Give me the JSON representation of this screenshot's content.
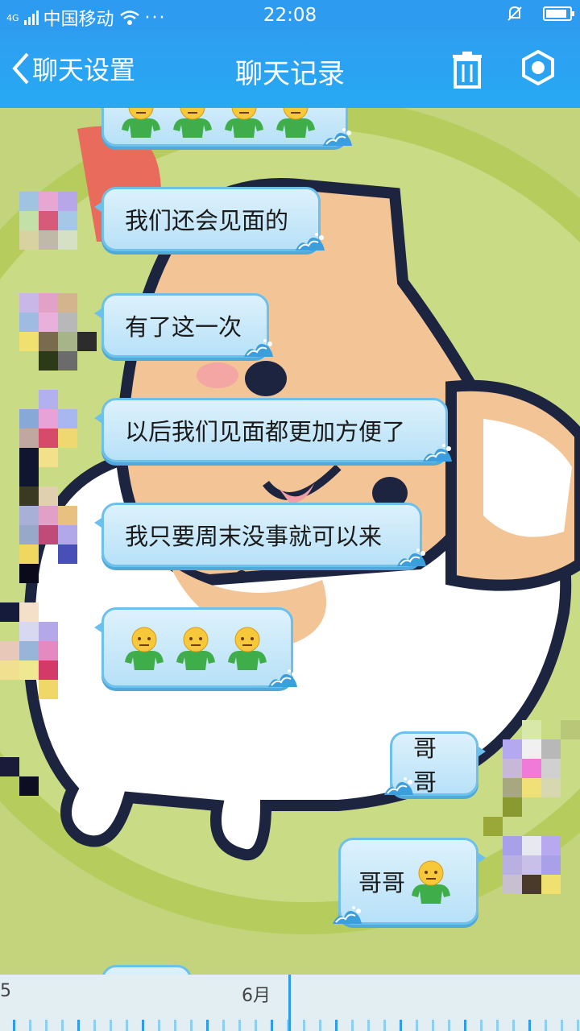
{
  "status_bar": {
    "network": "4G",
    "carrier": "中国移动",
    "time": "22:08",
    "battery_level": 0.9
  },
  "header": {
    "back_label": "聊天设置",
    "title": "聊天记录",
    "delete_icon": "trash-icon",
    "settings_icon": "settings-icon"
  },
  "messages": [
    {
      "side": "left",
      "text": "",
      "emoji_count": 4
    },
    {
      "side": "left",
      "text": "我们还会见面的"
    },
    {
      "side": "left",
      "text": "有了这一次"
    },
    {
      "side": "left",
      "text": "以后我们见面都更加方便了"
    },
    {
      "side": "left",
      "text": "我只要周末没事就可以来"
    },
    {
      "side": "left",
      "text": "",
      "emoji_count": 3
    },
    {
      "side": "right",
      "text": "哥哥"
    },
    {
      "side": "right",
      "text": "哥哥",
      "emoji_count": 1
    }
  ],
  "timeline": {
    "prev_label": "5",
    "current_label": "6月"
  },
  "colors": {
    "header": "#2c9bf0",
    "bubble_fill": "#cdeaf9",
    "bubble_border": "#6cc0eb",
    "background": "#bfd27a"
  }
}
